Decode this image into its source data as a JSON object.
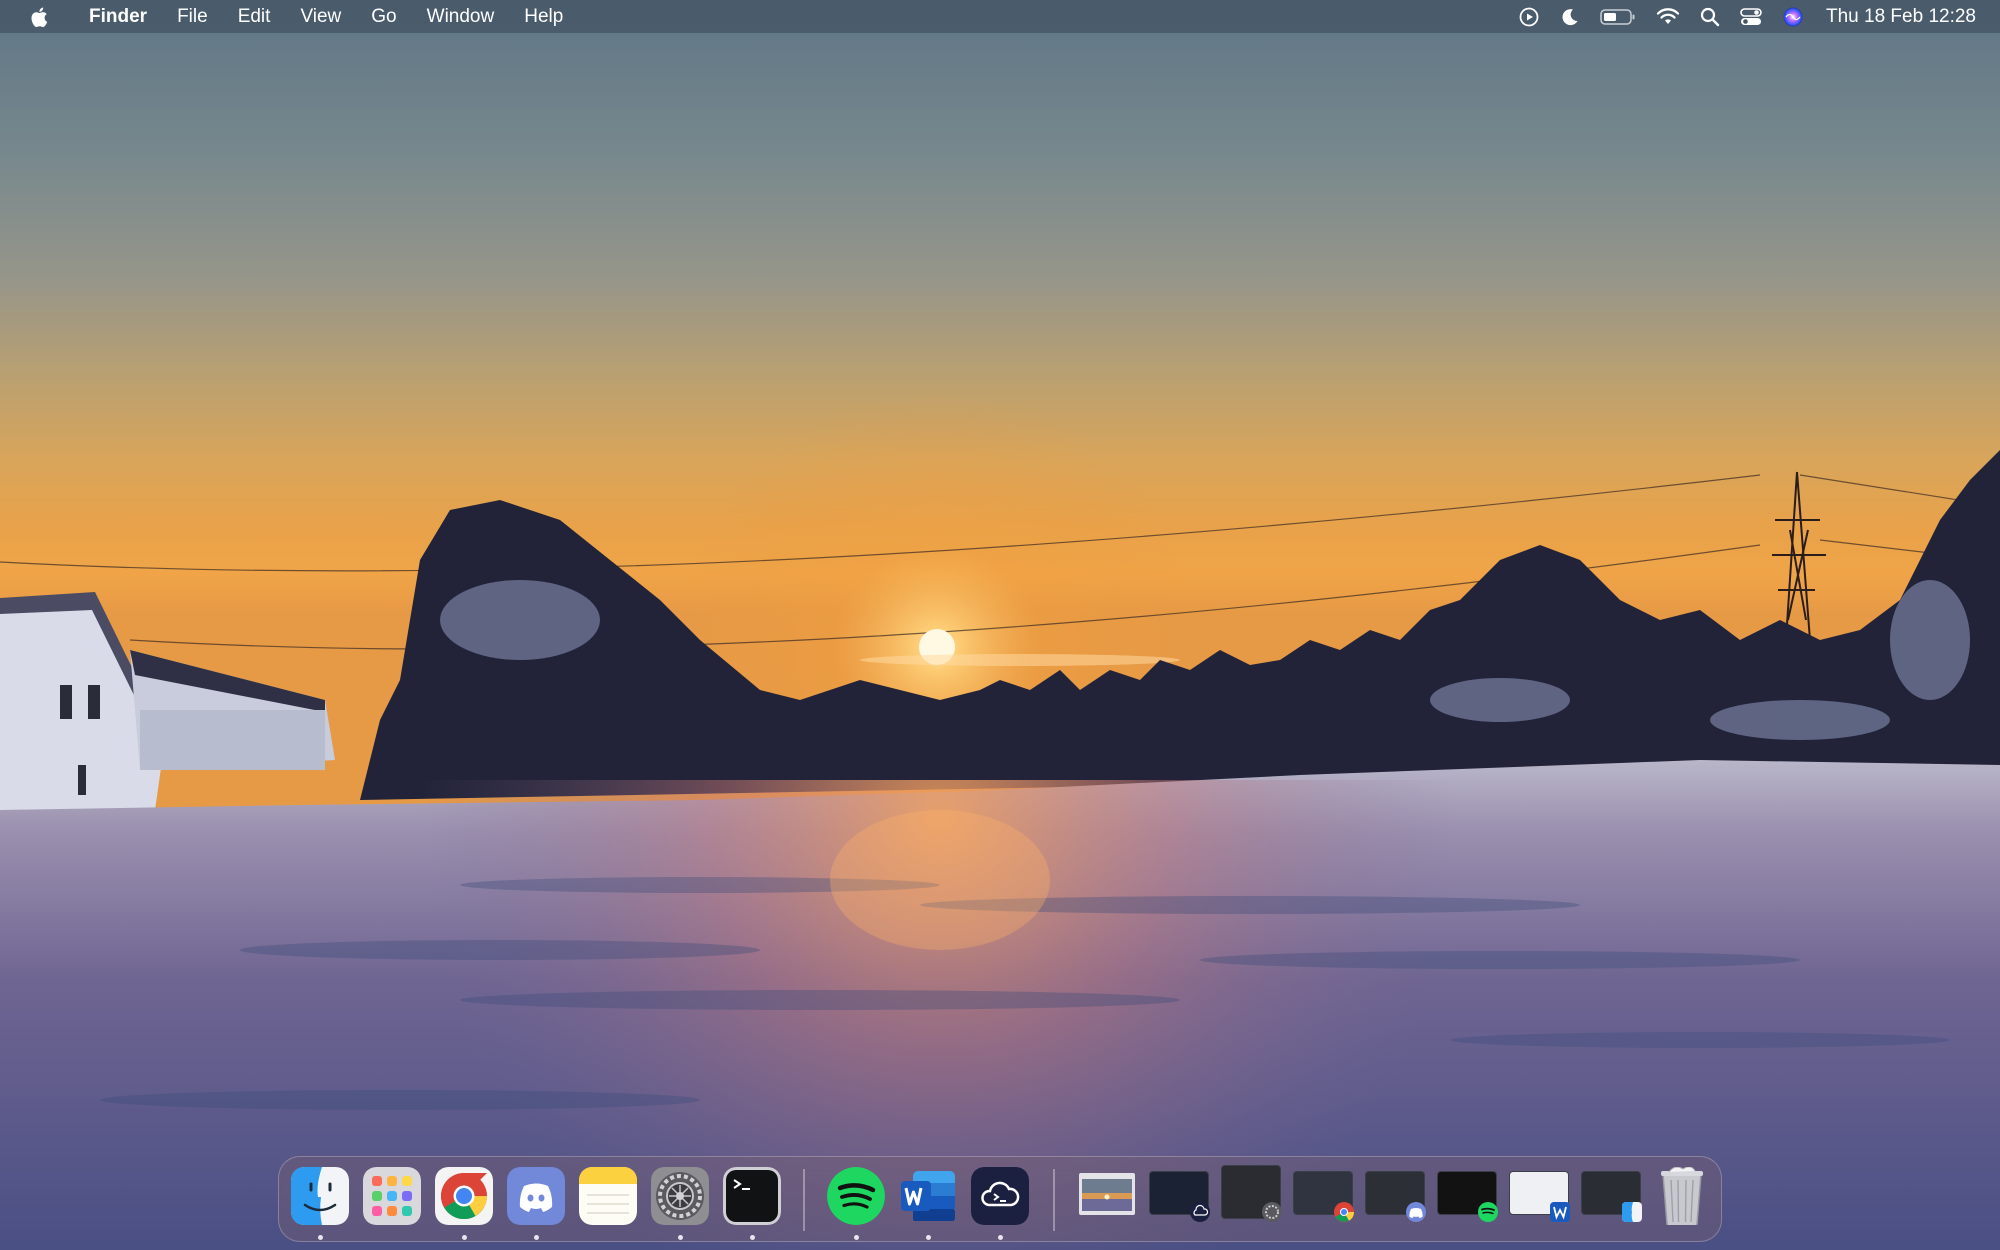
{
  "menubar": {
    "app_name": "Finder",
    "menus": [
      "File",
      "Edit",
      "View",
      "Go",
      "Window",
      "Help"
    ],
    "status_icons": [
      "now-playing-icon",
      "do-not-disturb-moon-icon",
      "battery-icon",
      "wifi-icon",
      "spotlight-search-icon",
      "control-center-icon",
      "siri-icon"
    ],
    "clock": "Thu 18 Feb  12:28"
  },
  "dock": {
    "apps": [
      {
        "name": "Finder",
        "icon": "finder-icon",
        "running": true
      },
      {
        "name": "Launchpad",
        "icon": "launchpad-icon",
        "running": false
      },
      {
        "name": "Google Chrome",
        "icon": "chrome-icon",
        "running": true
      },
      {
        "name": "Discord",
        "icon": "discord-icon",
        "running": true
      },
      {
        "name": "Notes",
        "icon": "notes-icon",
        "running": false
      },
      {
        "name": "System Preferences",
        "icon": "system-preferences-icon",
        "running": true
      },
      {
        "name": "Terminal",
        "icon": "terminal-icon",
        "running": true
      },
      {
        "name": "Spotify",
        "icon": "spotify-icon",
        "running": true
      },
      {
        "name": "Microsoft Word",
        "icon": "word-icon",
        "running": true
      },
      {
        "name": "Cloud App",
        "icon": "cloud-app-icon",
        "running": true
      }
    ],
    "minimized_windows": [
      {
        "icon": "desktop-picture-thumbnail-icon"
      },
      {
        "icon": "cloud-app-window-thumbnail-icon"
      },
      {
        "icon": "system-preferences-window-thumbnail-icon"
      },
      {
        "icon": "chrome-window-thumbnail-icon"
      },
      {
        "icon": "discord-window-thumbnail-icon"
      },
      {
        "icon": "spotify-window-thumbnail-icon"
      },
      {
        "icon": "word-window-thumbnail-icon"
      },
      {
        "icon": "finder-window-thumbnail-icon"
      }
    ],
    "trash": {
      "icon": "trash-icon"
    }
  },
  "colors": {
    "menubar_bg": "#465666",
    "sky_top": "#5f7586",
    "sun": "#fff6d8",
    "snow_shadow": "#3a4a78"
  }
}
